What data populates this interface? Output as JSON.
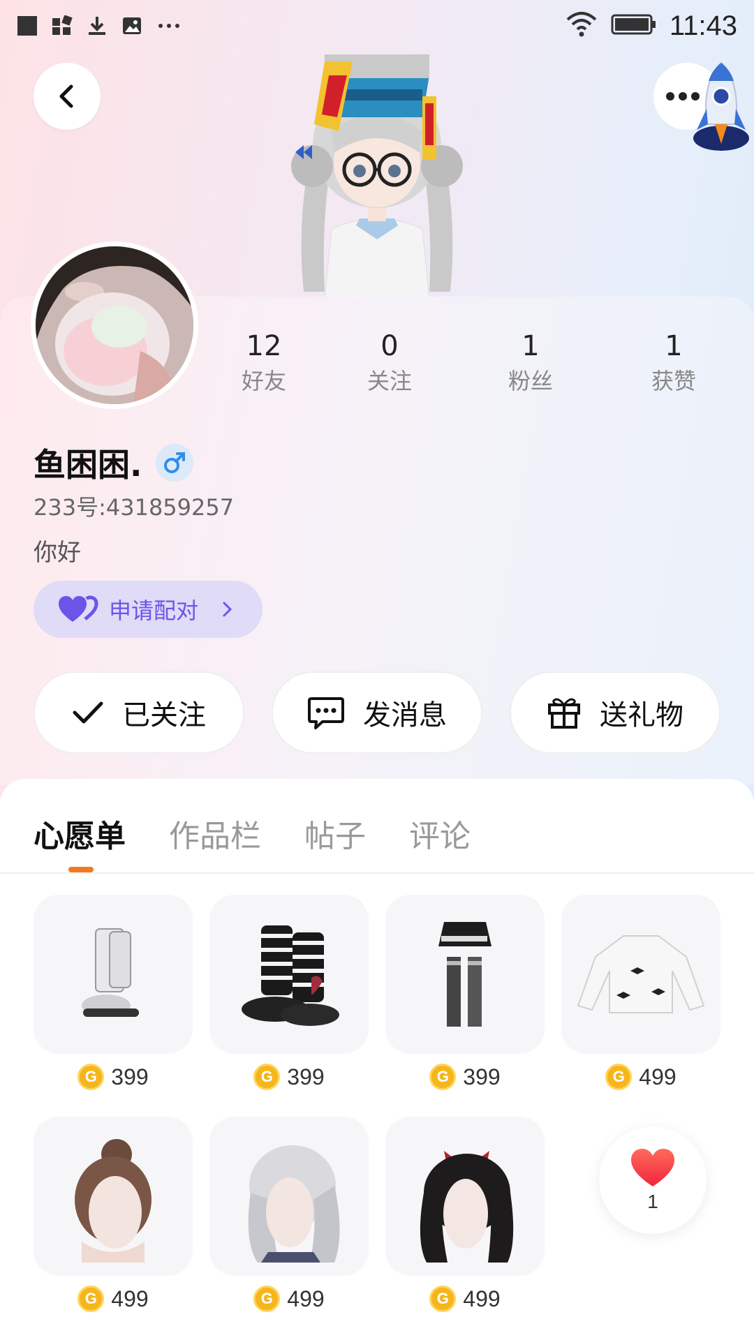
{
  "status_bar": {
    "time": "11:43",
    "icons": [
      "square-icon",
      "widget-icon",
      "download-icon",
      "image-icon",
      "more-notifications-icon",
      "wifi-icon",
      "battery-icon"
    ],
    "overflow": "···"
  },
  "header": {
    "back_icon": "chevron-left-icon",
    "more_icon": "more-horizontal-icon",
    "rocket_icon": "rocket-icon"
  },
  "profile": {
    "stats": [
      {
        "value": "12",
        "label": "好友"
      },
      {
        "value": "0",
        "label": "关注"
      },
      {
        "value": "1",
        "label": "粉丝"
      },
      {
        "value": "1",
        "label": "获赞"
      }
    ],
    "name": "鱼困困.",
    "gender_icon": "male-icon",
    "uid": "233号:431859257",
    "bio": "你好",
    "pair_button": "申请配对"
  },
  "actions": {
    "follow_label": "已关注",
    "message_label": "发消息",
    "gift_label": "送礼物"
  },
  "tabs": [
    {
      "label": "心愿单",
      "active": true
    },
    {
      "label": "作品栏",
      "active": false
    },
    {
      "label": "帖子",
      "active": false
    },
    {
      "label": "评论",
      "active": false
    }
  ],
  "wishlist": [
    {
      "name": "white-boots",
      "price": "399"
    },
    {
      "name": "striped-boots",
      "price": "399"
    },
    {
      "name": "skirt-stockings",
      "price": "399"
    },
    {
      "name": "white-sweater",
      "price": "499"
    },
    {
      "name": "bun-hair",
      "price": "499"
    },
    {
      "name": "silver-long-hair",
      "price": "499"
    },
    {
      "name": "black-twintail-hair",
      "price": "499"
    }
  ],
  "like": {
    "count": "1"
  },
  "colors": {
    "accent_orange": "#f07a22",
    "pair_purple": "#6b55e8",
    "coin_gold": "#f6b51c"
  }
}
